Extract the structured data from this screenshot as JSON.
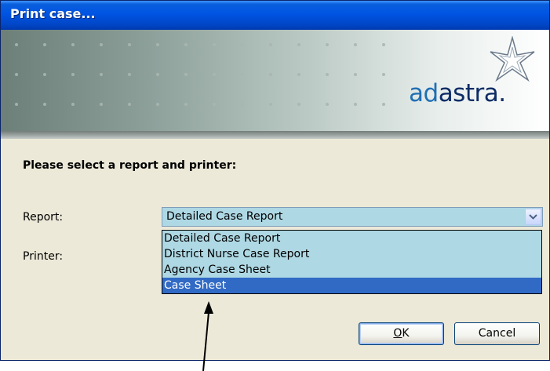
{
  "window": {
    "title": "Print case..."
  },
  "banner": {
    "logo_part1": "ad",
    "logo_part2": "astra",
    "logo_dot": "."
  },
  "form": {
    "heading": "Please select a report and printer:",
    "report_label": "Report:",
    "printer_label": "Printer:",
    "report_selected": "Detailed Case Report",
    "report_options": [
      "Detailed Case Report",
      "District Nurse Case Report",
      "Agency Case Sheet",
      "Case Sheet"
    ],
    "highlighted_option_index": 3
  },
  "buttons": {
    "ok_label_mnemonic": "O",
    "ok_label_rest": "K",
    "cancel_label": "Cancel"
  },
  "colors": {
    "titlebar": "#0054e3",
    "dialog_bg": "#ece9d8",
    "combo_bg": "#aed8e4",
    "selection": "#316ac5"
  }
}
